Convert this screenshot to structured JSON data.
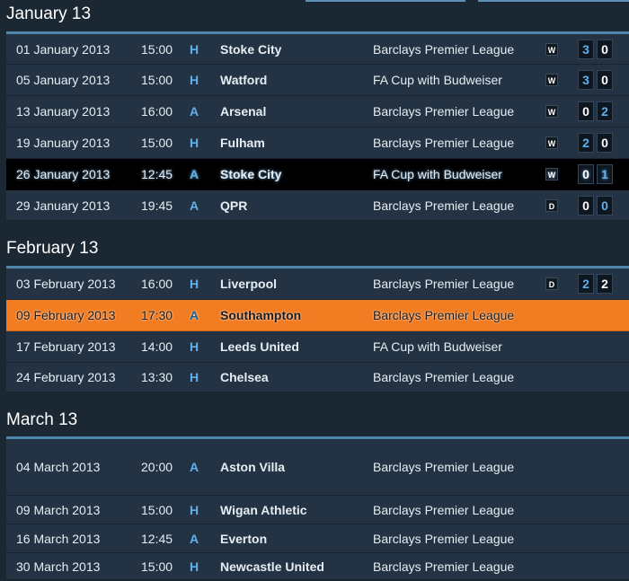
{
  "months": [
    {
      "title": "January 13",
      "fixtures": [
        {
          "date": "01 January 2013",
          "time": "15:00",
          "venue": "H",
          "opponent": "Stoke City",
          "competition": "Barclays Premier League",
          "result": "W",
          "home_score": "3",
          "away_score": "0"
        },
        {
          "date": "05 January 2013",
          "time": "15:00",
          "venue": "H",
          "opponent": "Watford",
          "competition": "FA Cup with Budweiser",
          "result": "W",
          "home_score": "3",
          "away_score": "0"
        },
        {
          "date": "13 January 2013",
          "time": "16:00",
          "venue": "A",
          "opponent": "Arsenal",
          "competition": "Barclays Premier League",
          "result": "W",
          "home_score": "0",
          "away_score": "2"
        },
        {
          "date": "19 January 2013",
          "time": "15:00",
          "venue": "H",
          "opponent": "Fulham",
          "competition": "Barclays Premier League",
          "result": "W",
          "home_score": "2",
          "away_score": "0"
        },
        {
          "date": "26 January 2013",
          "time": "12:45",
          "venue": "A",
          "opponent": "Stoke City",
          "competition": "FA Cup with Budweiser",
          "result": "W",
          "home_score": "0",
          "away_score": "1"
        },
        {
          "date": "29 January 2013",
          "time": "19:45",
          "venue": "A",
          "opponent": "QPR",
          "competition": "Barclays Premier League",
          "result": "D",
          "home_score": "0",
          "away_score": "0"
        }
      ]
    },
    {
      "title": "February 13",
      "fixtures": [
        {
          "date": "03 February 2013",
          "time": "16:00",
          "venue": "H",
          "opponent": "Liverpool",
          "competition": "Barclays Premier League",
          "result": "D",
          "home_score": "2",
          "away_score": "2"
        },
        {
          "date": "09 February 2013",
          "time": "17:30",
          "venue": "A",
          "opponent": "Southampton",
          "competition": "Barclays Premier League",
          "result": "",
          "home_score": "",
          "away_score": ""
        },
        {
          "date": "17 February 2013",
          "time": "14:00",
          "venue": "H",
          "opponent": "Leeds United",
          "competition": "FA Cup with Budweiser",
          "result": "",
          "home_score": "",
          "away_score": ""
        },
        {
          "date": "24 February 2013",
          "time": "13:30",
          "venue": "H",
          "opponent": "Chelsea",
          "competition": "Barclays Premier League",
          "result": "",
          "home_score": "",
          "away_score": ""
        }
      ]
    },
    {
      "title": "March 13",
      "fixtures": [
        {
          "date": "04 March 2013",
          "time": "20:00",
          "venue": "A",
          "opponent": "Aston Villa",
          "competition": "Barclays Premier League",
          "result": "",
          "home_score": "",
          "away_score": ""
        },
        {
          "date": "09 March 2013",
          "time": "15:00",
          "venue": "H",
          "opponent": "Wigan Athletic",
          "competition": "Barclays Premier League",
          "result": "",
          "home_score": "",
          "away_score": ""
        },
        {
          "date": "16 March 2013",
          "time": "12:45",
          "venue": "A",
          "opponent": "Everton",
          "competition": "Barclays Premier League",
          "result": "",
          "home_score": "",
          "away_score": ""
        },
        {
          "date": "30 March 2013",
          "time": "15:00",
          "venue": "H",
          "opponent": "Newcastle United",
          "competition": "Barclays Premier League",
          "result": "",
          "home_score": "",
          "away_score": ""
        }
      ]
    }
  ],
  "colors": {
    "background": "#1c2734",
    "row": "#243343",
    "accent": "#4f86ab",
    "venue": "#5fb0ec",
    "selected_row": "#000000",
    "highlight_row": "#f27c21"
  }
}
